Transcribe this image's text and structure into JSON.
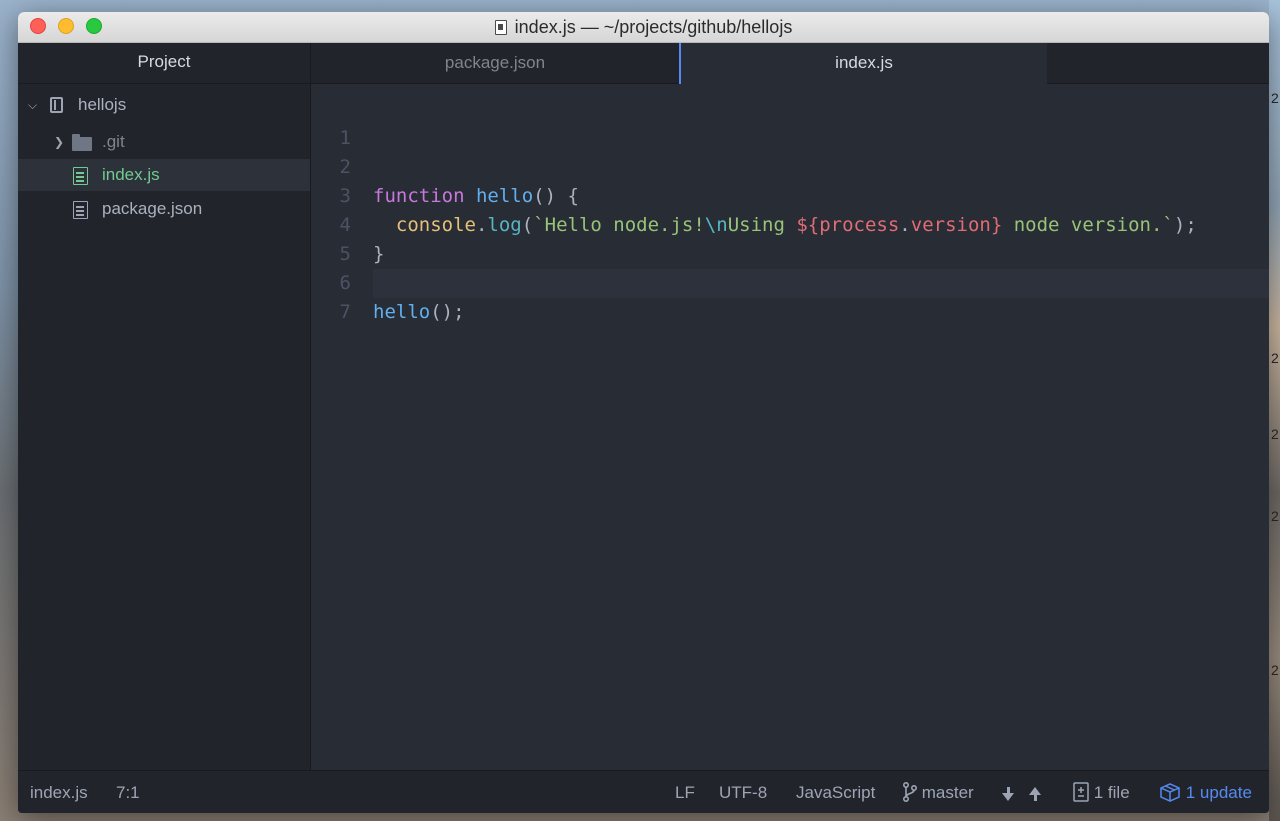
{
  "window": {
    "title": "index.js — ~/projects/github/hellojs"
  },
  "sidebar": {
    "header": "Project",
    "root": "hellojs",
    "items": [
      {
        "label": ".git",
        "type": "folder"
      },
      {
        "label": "index.js",
        "type": "file",
        "selected": true
      },
      {
        "label": "package.json",
        "type": "file"
      }
    ]
  },
  "tabs": [
    {
      "label": "package.json",
      "active": false
    },
    {
      "label": "index.js",
      "active": true
    }
  ],
  "editor": {
    "line_numbers": [
      "1",
      "2",
      "3",
      "4",
      "5",
      "6",
      "7"
    ],
    "lines": [
      "",
      "function hello() {",
      "  console.log(`Hello node.js!\\nUsing ${process.version} node version.`);",
      "}",
      "",
      "hello();",
      ""
    ],
    "tokens": {
      "kw_function": "function",
      "fn_hello": "hello",
      "paren_open": "() {",
      "obj_console": "console",
      "dot": ".",
      "fn_log": "log",
      "open_paren": "(",
      "str_start": "`Hello node.js!",
      "esc_n": "\\n",
      "str_using": "Using ",
      "tpl_open": "${",
      "tpl_process": "process",
      "tpl_dot": ".",
      "tpl_version": "version",
      "tpl_close": "}",
      "str_end": " node version.`",
      "close_paren": ");",
      "brace_close": "}",
      "call_hello": "hello",
      "call_tail": "();"
    }
  },
  "statusbar": {
    "file": "index.js",
    "cursor": "7:1",
    "line_ending": "LF",
    "encoding": "UTF-8",
    "grammar": "JavaScript",
    "branch": "master",
    "changes": "1 file",
    "updates": "1 update"
  },
  "desktop": {
    "edge_digits": [
      "2",
      "2",
      "2",
      "2",
      "2"
    ]
  },
  "colors": {
    "accent": "#568af2",
    "keyword": "#c678dd",
    "function": "#61afef",
    "string": "#98c379",
    "object": "#e5c07b",
    "template": "#e06c75",
    "escape": "#56b6c2"
  }
}
